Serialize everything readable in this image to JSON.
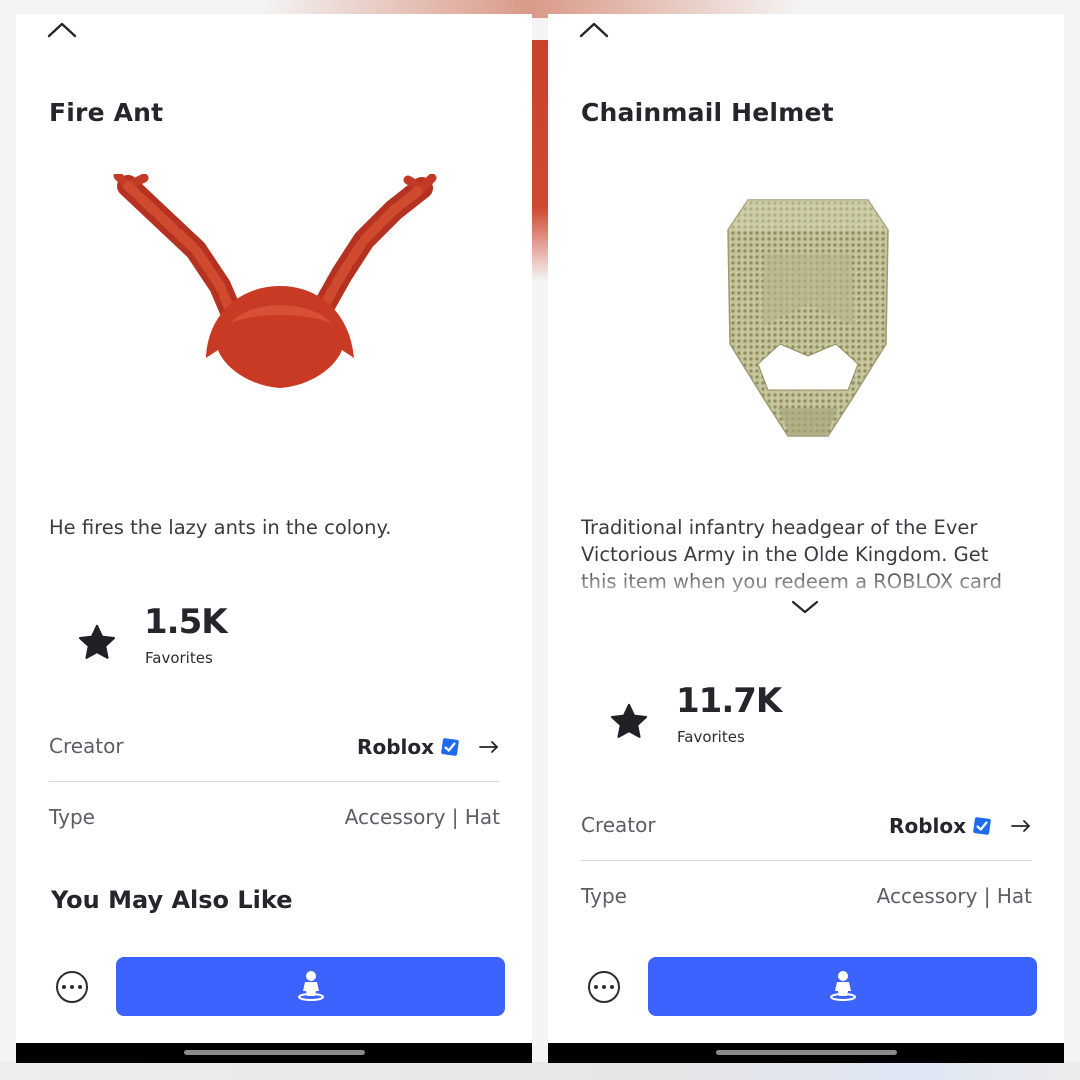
{
  "panels": [
    {
      "title": "Fire Ant",
      "description": "He fires the lazy ants in the colony.",
      "favorites": {
        "count": "1.5K",
        "label": "Favorites"
      },
      "creator": {
        "label": "Creator",
        "name": "Roblox",
        "verified": true
      },
      "type": {
        "label": "Type",
        "value": "Accessory | Hat"
      },
      "section_heading": "You May Also Like",
      "item_icon": "fire-ant-antennae-hat",
      "item_color": "#c93a24"
    },
    {
      "title": "Chainmail Helmet",
      "description": "Traditional infantry headgear of the Ever Victorious Army in the Olde Kingdom.  Get this item when you redeem a ROBLOX card",
      "description_truncated": true,
      "favorites": {
        "count": "11.7K",
        "label": "Favorites"
      },
      "creator": {
        "label": "Creator",
        "name": "Roblox",
        "verified": true
      },
      "type": {
        "label": "Type",
        "value": "Accessory | Hat"
      },
      "item_icon": "chainmail-helmet",
      "item_color": "#bfbe8e"
    }
  ],
  "icons": {
    "collapse": "chevron-up-icon",
    "expand": "chevron-down-icon",
    "favorite": "star-icon",
    "verified": "verified-badge-icon",
    "open_creator": "arrow-right-icon",
    "more": "more-options-icon",
    "try_on": "avatar-try-on-icon"
  },
  "colors": {
    "accent": "#3d63ff",
    "verified": "#1e6bf0",
    "text_primary": "#24262b",
    "text_secondary": "#5b5e65"
  }
}
